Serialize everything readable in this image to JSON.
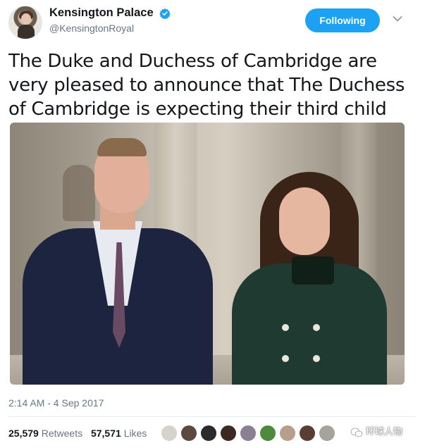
{
  "account": {
    "display_name": "Kensington Palace",
    "handle": "@KensingtonRoyal",
    "verified_icon": "verified-badge-icon"
  },
  "actions": {
    "follow_label": "Following",
    "menu_icon": "chevron-down-icon"
  },
  "tweet": {
    "text": "The Duke and Duchess of Cambridge are very pleased to announce that The Duchess of Cambridge is expecting their third child",
    "timestamp": "2:14 AM - 4 Sep 2017"
  },
  "stats": {
    "retweets_count": "25,579",
    "retweets_label": "Retweets",
    "likes_count": "57,571",
    "likes_label": "Likes"
  },
  "watermark": {
    "text": "环球人物"
  },
  "colors": {
    "accent": "#1da1f2",
    "text_primary": "#14171a",
    "text_secondary": "#657786"
  }
}
